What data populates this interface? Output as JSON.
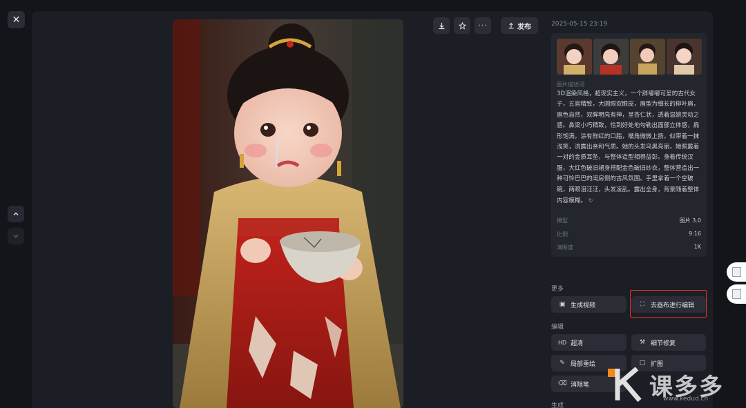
{
  "viewer": {
    "close_icon": "close-icon",
    "nav_up_icon": "chevron-up-icon",
    "nav_down_icon": "chevron-down-icon"
  },
  "toolbar": {
    "download_icon": "download-icon",
    "favorite_icon": "star-icon",
    "more_icon": "more-icon",
    "publish_label": "发布"
  },
  "details": {
    "timestamp": "2025-05-15 23:19",
    "prompt_label": "图片描述词",
    "prompt_text": "3D渲染风格，超现实主义，一个胖嘟嘟可爱的古代女子，五官精致，大圆眼双眼皮，眉型为细长的柳叶眉，眉色自然，双眸明亮有神，呈杏仁状，透着温婉灵动之感。鼻梁小巧精致，恰到好处地勾勒出面部立体感，扁形饱满，涂有鲜红的口脂，嘴角微微上扬，似带着一抹浅笑，流露出亲和气质。她的头发乌黑亮丽，她佩戴着一对的金质耳坠，与整体造型相得益彰。身着传统汉服，大红色破旧裙身搭配金色破旧纱衣，整体营造出一种可怜巴巴的闺房侧的古风氛围。手里拿着一个空破碗，两眼泪汪汪，头发凌乱。露出全身，背景随着整体内容模糊。",
    "meta": [
      {
        "key": "模型",
        "value": "图片 3.0"
      },
      {
        "key": "比例",
        "value": "9:16"
      },
      {
        "key": "清晰度",
        "value": "1K"
      }
    ]
  },
  "sections": {
    "more_title": "更多",
    "edit_title": "编辑",
    "generate_title": "生成"
  },
  "actions": {
    "generate_video": "生成视频",
    "edit_on_canvas": "去画布进行编辑",
    "hd_prefix": "HD",
    "upscale": "超清",
    "detail_fix": "细节修复",
    "inpaint": "局部重绘",
    "expand": "扩图",
    "eraser": "消除笔"
  },
  "watermark": {
    "text": "课多多",
    "url": "www.kedud.cn"
  }
}
